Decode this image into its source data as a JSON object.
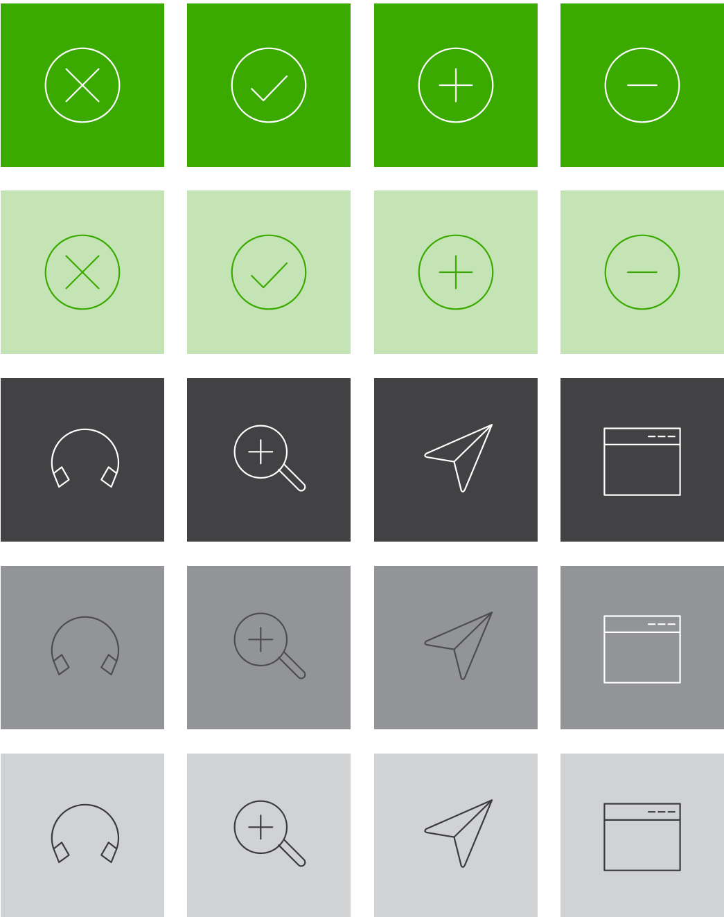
{
  "palette": {
    "green": "#3aaa00",
    "light_green": "#c5e4b5",
    "dark_gray": "#424244",
    "mid_gray": "#939497",
    "light_gray": "#d1d2d4",
    "icon_white": "#ffffff",
    "icon_green": "#3aaa00",
    "icon_mid": "#4d4d4f",
    "icon_dark": "#3a3a3c"
  },
  "rows": [
    {
      "background": "#3aaa00",
      "icon_color": "#ffffff",
      "icons": [
        "close-circle-icon",
        "check-circle-icon",
        "plus-circle-icon",
        "minus-circle-icon"
      ]
    },
    {
      "background": "#c5e4b5",
      "icon_color": "#3aaa00",
      "icons": [
        "close-circle-icon",
        "check-circle-icon",
        "plus-circle-icon",
        "minus-circle-icon"
      ]
    },
    {
      "background": "#424244",
      "icon_color": "#ffffff",
      "icons": [
        "headphones-icon",
        "zoom-in-icon",
        "send-icon",
        "browser-window-icon"
      ]
    },
    {
      "background": "#939497",
      "icon_color": "#4d4d4f",
      "icons": [
        "headphones-icon",
        "zoom-in-icon",
        "send-icon",
        "browser-window-icon"
      ],
      "icon_color_overrides": {
        "browser-window-icon": "#ffffff"
      }
    },
    {
      "background": "#d1d2d4",
      "icon_color": "#3a3a3c",
      "icons": [
        "headphones-icon",
        "zoom-in-icon",
        "send-icon",
        "browser-window-icon"
      ]
    }
  ]
}
